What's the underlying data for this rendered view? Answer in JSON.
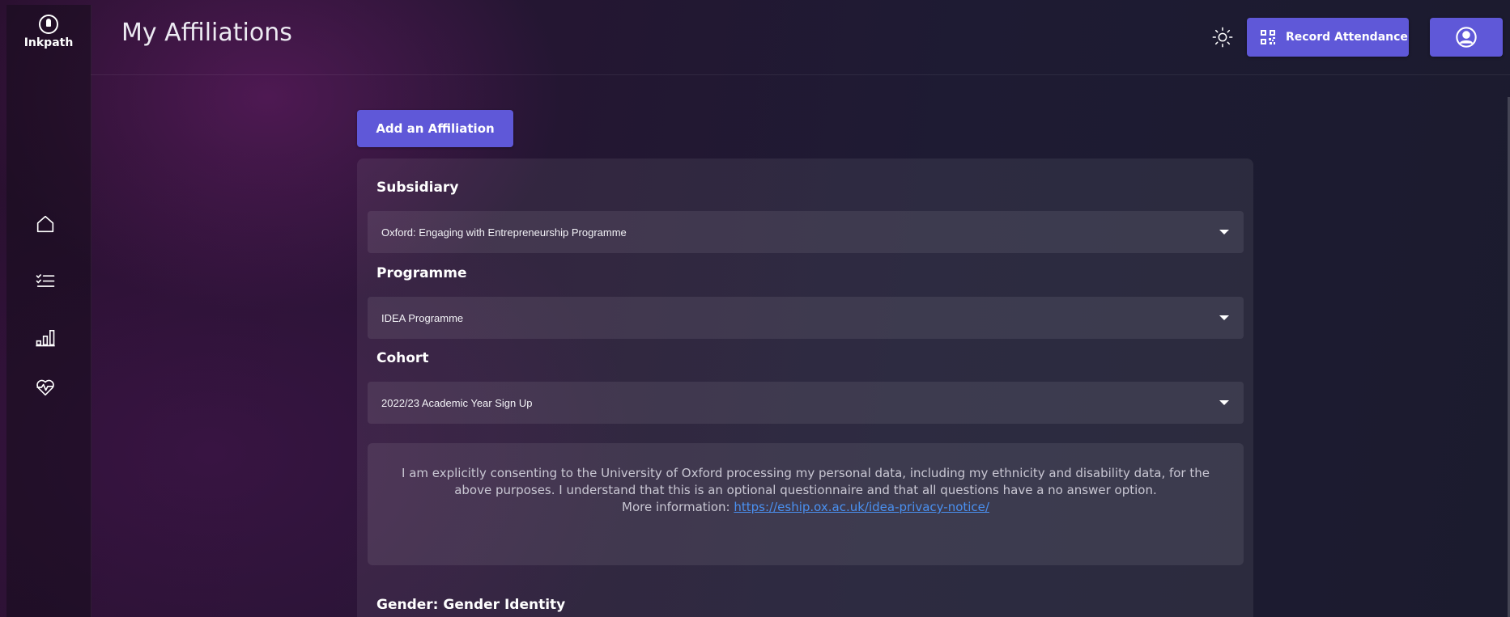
{
  "app": {
    "name": "Inkpath"
  },
  "header": {
    "title": "My Affiliations",
    "record_attendance_label": "Record Attendance"
  },
  "sidebar": {
    "items": [
      {
        "icon": "home-icon"
      },
      {
        "icon": "checklist-icon"
      },
      {
        "icon": "bar-chart-icon"
      },
      {
        "icon": "heart-pulse-icon"
      }
    ]
  },
  "main": {
    "add_affiliation_label": "Add an Affiliation",
    "fields": {
      "subsidiary": {
        "label": "Subsidiary",
        "value": "Oxford: Engaging with Entrepreneurship Programme"
      },
      "programme": {
        "label": "Programme",
        "value": "IDEA Programme"
      },
      "cohort": {
        "label": "Cohort",
        "value": "2022/23 Academic Year Sign Up"
      }
    },
    "consent": {
      "text": "I am explicitly consenting to the University of Oxford processing my personal data, including my ethnicity and disability data, for the above purposes. I understand that this is an optional questionnaire and that all questions have a no answer option.",
      "more_info_label": "More information:",
      "link_text": "https://eship.ox.ac.uk/idea-privacy-notice/"
    },
    "next_section_label": "Gender: Gender Identity"
  },
  "colors": {
    "accent": "#5f58d8",
    "link": "#4a90f0"
  }
}
